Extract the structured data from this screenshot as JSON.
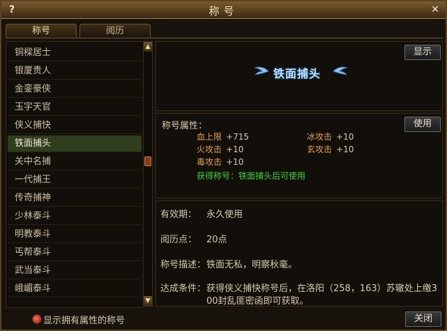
{
  "window": {
    "title": "称号",
    "help_glyph": "?",
    "close_glyph": "✕"
  },
  "tabs": [
    {
      "label": "称号"
    },
    {
      "label": "阅历"
    }
  ],
  "title_list": [
    {
      "label": "铜樑居士"
    },
    {
      "label": "银厦贵人"
    },
    {
      "label": "金銮豪侠"
    },
    {
      "label": "玉宇天官"
    },
    {
      "label": "侠义捕快"
    },
    {
      "label": "铁面捕头"
    },
    {
      "label": "关中名捕"
    },
    {
      "label": "一代捕王"
    },
    {
      "label": "传奇捕神"
    },
    {
      "label": "少林泰斗"
    },
    {
      "label": "明教泰斗"
    },
    {
      "label": "丐帮泰斗"
    },
    {
      "label": "武当泰斗"
    },
    {
      "label": "峨嵋泰斗"
    }
  ],
  "selected_index": 5,
  "display_panel": {
    "button_label": "显示",
    "badge_title": "铁面捕头"
  },
  "attributes_panel": {
    "header": "称号属性：",
    "use_button_label": "使用",
    "attributes": [
      {
        "name": "血上限",
        "value": "+715"
      },
      {
        "name": "冰攻击",
        "value": "+10"
      },
      {
        "name": "火攻击",
        "value": "+10"
      },
      {
        "name": "玄攻击",
        "value": "+10"
      },
      {
        "name": "毒攻击",
        "value": "+10"
      }
    ],
    "acquire_note": "获得称号：铁面捕头后可使用"
  },
  "info_panel": {
    "validity_label": "有效期：",
    "validity_value": "永久使用",
    "experience_label": "阅历点：",
    "experience_value": "20点",
    "description_label": "称号描述：",
    "description_value": "铁面无私，明察秋毫。",
    "condition_label": "达成条件：",
    "condition_value_line1": "获得侠义捕快称号后，在洛阳（258，163）苏辙处上缴3",
    "condition_value_line2": "00封乱匪密函即可获取。"
  },
  "footer": {
    "checkbox_label": "显示拥有属性的称号",
    "close_button_label": "关闭"
  },
  "colors": {
    "attr_name": "#e3a25a",
    "acquire_note": "#45d23d",
    "badge_text": "#b8e1ff",
    "selected_row": "#2f3e1c"
  }
}
